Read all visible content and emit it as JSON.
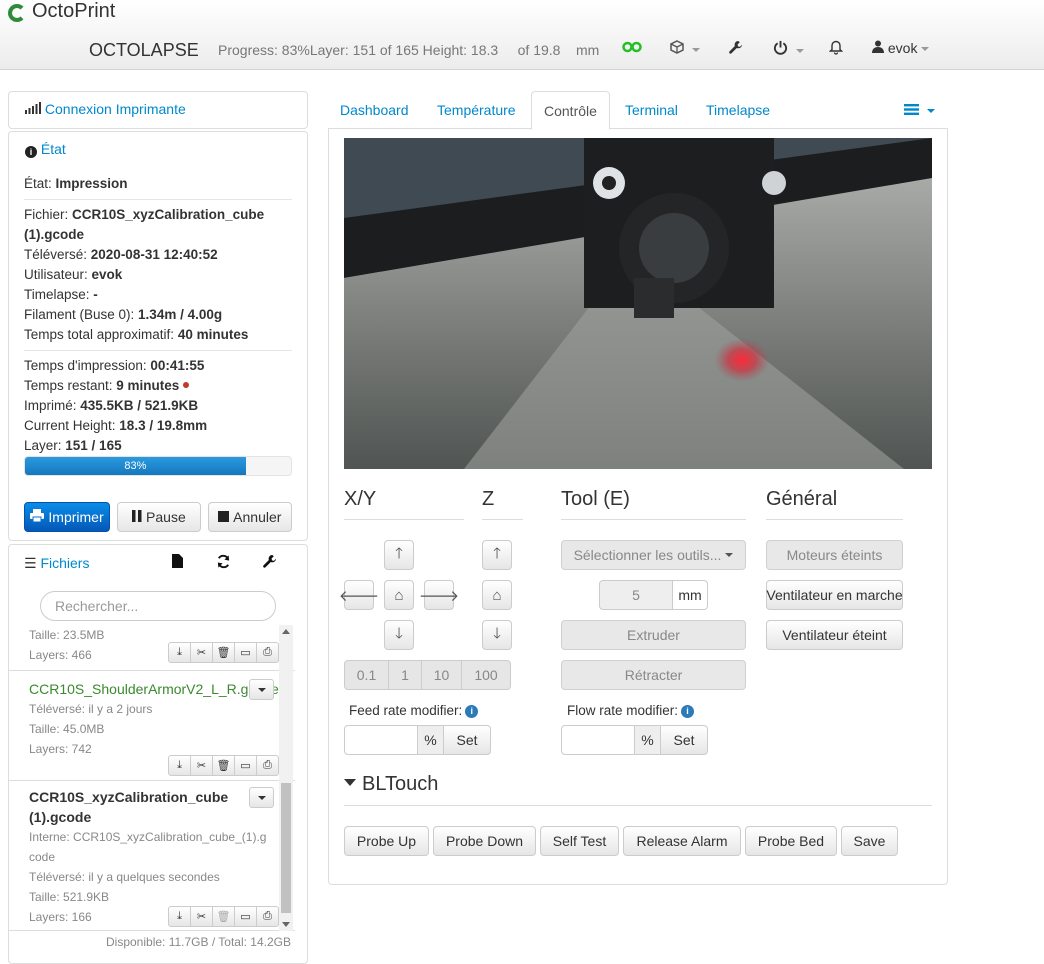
{
  "navbar": {
    "brand": "OctoPrint",
    "plugin": "OCTOLAPSE",
    "progress_text": "Progress: 83%Layer: 151 of 165 Height: 18.3     of 19.8    mm",
    "user": "evok"
  },
  "connection": {
    "title": "Connexion Imprimante"
  },
  "state": {
    "title": "État",
    "etat_label": "État: ",
    "etat_value": "Impression",
    "file_label": "Fichier: ",
    "file_value": "CCR10S_xyzCalibration_cube (1).gcode",
    "uploaded_label": "Téléversé: ",
    "uploaded_value": "2020-08-31 12:40:52",
    "user_label": "Utilisateur: ",
    "user_value": "evok",
    "timelapse_label": "Timelapse: ",
    "timelapse_value": "-",
    "filament_label": "Filament (Buse 0): ",
    "filament_value": "1.34m / 4.00g",
    "approx_label": "Temps total approximatif: ",
    "approx_value": "40 minutes",
    "print_time_label": "Temps d'impression: ",
    "print_time_value": "00:41:55",
    "remaining_label": "Temps restant: ",
    "remaining_value": "9 minutes",
    "printed_label": "Imprimé: ",
    "printed_value": "435.5KB / 521.9KB",
    "height_label": "Current Height: ",
    "height_value": "18.3 / 19.8mm",
    "layer_label": "Layer: ",
    "layer_value": "151 / 165",
    "progress_text": "83%",
    "progress_fraction": 0.83,
    "buttons": {
      "print": "Imprimer",
      "pause": "Pause",
      "cancel": "Annuler"
    }
  },
  "files": {
    "title": "Fichiers",
    "search_placeholder": "Rechercher...",
    "items": [
      {
        "name": "",
        "size": "Taille: 23.5MB",
        "layers": "Layers: 466"
      },
      {
        "name": "CCR10S_ShoulderArmorV2_L_R.gcode",
        "uploaded": "Téléversé: il y a 2 jours",
        "size": "Taille: 45.0MB",
        "layers": "Layers: 742"
      },
      {
        "name": "CCR10S_xyzCalibration_cube (1).gcode",
        "internal": "Interne: CCR10S_xyzCalibration_cube_(1).gcode",
        "uploaded": "Téléversé: il y a quelques secondes",
        "size": "Taille: 521.9KB",
        "layers": "Layers: 166"
      }
    ],
    "footer": "Disponible: 11.7GB / Total: 14.2GB"
  },
  "tabs": [
    "Dashboard",
    "Température",
    "Contrôle",
    "Terminal",
    "Timelapse"
  ],
  "control": {
    "xy_title": "X/Y",
    "z_title": "Z",
    "tool_title": "Tool (E)",
    "general_title": "Général",
    "steps": [
      "0.1",
      "1",
      "10",
      "100"
    ],
    "select_tools": "Sélectionner les outils...",
    "extrude_amount": "5",
    "unit_mm": "mm",
    "extrude": "Extruder",
    "retract": "Rétracter",
    "motors_off": "Moteurs éteints",
    "fan_on": "Ventilateur en marche",
    "fan_off": "Ventilateur éteint",
    "feed_rate_label": "Feed rate modifier:",
    "flow_rate_label": "Flow rate modifier:",
    "percent": "%",
    "set": "Set",
    "bltouch_title": "BLTouch",
    "bltouch_buttons": [
      "Probe Up",
      "Probe Down",
      "Self Test",
      "Release Alarm",
      "Probe Bed",
      "Save"
    ]
  },
  "colors": {
    "accent": "#0088cc",
    "primary_btn": "#0a6fd0",
    "progress": "#1e88cf",
    "file_green": "#3a8a2e"
  }
}
